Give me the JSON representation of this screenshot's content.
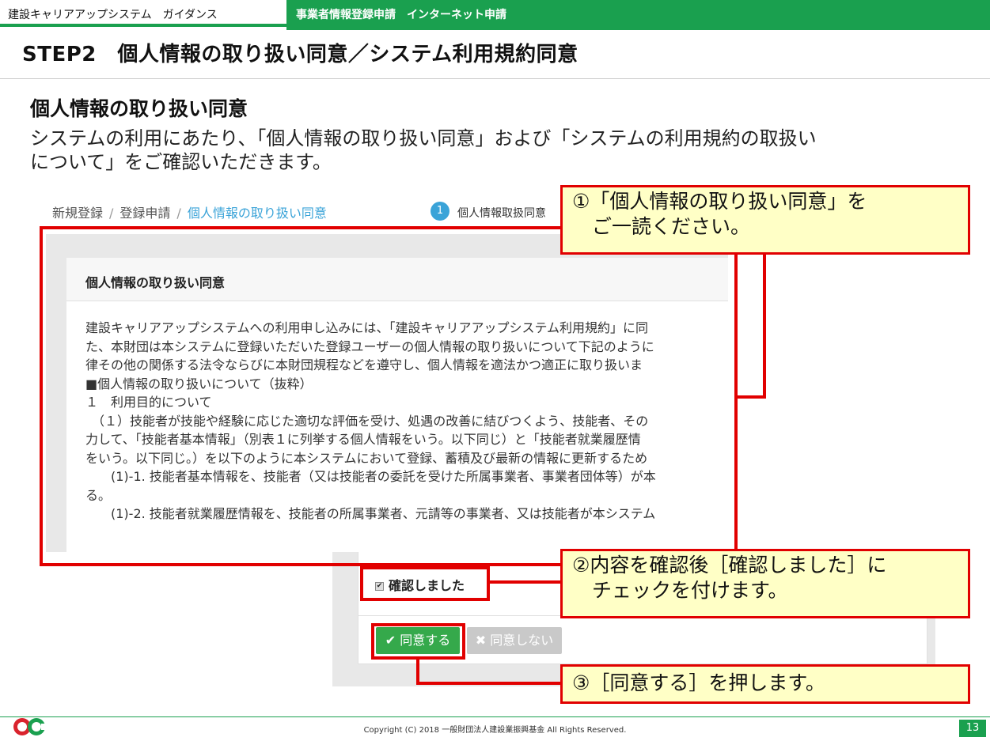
{
  "header": {
    "left_label": "建設キャリアアップシステム　ガイダンス",
    "right_label": "事業者情報登録申請　インターネット申請"
  },
  "step_title": "STEP2　個人情報の取り扱い同意／システム利用規約同意",
  "section": {
    "heading": "個人情報の取り扱い同意",
    "intro_line1": "システムの利用にあたり、「個人情報の取り扱い同意」および「システムの利用規約の取扱い",
    "intro_line2": "について」をご確認いただきます。"
  },
  "breadcrumb": {
    "items": [
      "新規登録",
      "登録申請",
      "個人情報の取り扱い同意"
    ],
    "separator": "/"
  },
  "step_indicator": {
    "number": "1",
    "label": "個人情報取扱同意"
  },
  "panel": {
    "title": "個人情報の取り扱い同意",
    "lines": [
      "建設キャリアアップシステムへの利用申し込みには、「建設キャリアアップシステム利用規約」に同",
      "た、本財団は本システムに登録いただいた登録ユーザーの個人情報の取り扱いについて下記のように",
      "律その他の関係する法令ならびに本財団規程などを遵守し、個人情報を適法かつ適正に取り扱いま",
      "■個人情報の取り扱いについて（抜粋）",
      "１　利用目的について",
      "　（１）技能者が技能や経験に応じた適切な評価を受け、処遇の改善に結びつくよう、技能者、その",
      "力して、「技能者基本情報」（別表１に列挙する個人情報をいう。以下同じ）と「技能者就業履歴情",
      "をいう。以下同じ。）を以下のように本システムにおいて登録、蓄積及び最新の情報に更新するため",
      "　　(1)-1. 技能者基本情報を、技能者（又は技能者の委託を受けた所属事業者、事業者団体等）が本",
      "る。",
      "　　(1)-2. 技能者就業履歴情報を、技能者の所属事業者、元請等の事業者、又は技能者が本システム"
    ]
  },
  "confirm": {
    "checkbox_label": "確認しました",
    "checked": true
  },
  "buttons": {
    "agree": "✔ 同意する",
    "disagree": "✖ 同意しない"
  },
  "callouts": {
    "c1_line1": "①「個人情報の取り扱い同意」を",
    "c1_line2": "　ご一読ください。",
    "c2_line1": "②内容を確認後［確認しました］に",
    "c2_line2": "　チェックを付けます。",
    "c3": "③［同意する］を押します。"
  },
  "footer": {
    "copyright": "Copyright (C) 2018 一般財団法人建設業振興基金 All Rights Reserved.",
    "page_number": "13"
  },
  "colors": {
    "brand_green": "#1aa04f",
    "highlight_red": "#e10000",
    "callout_yellow": "#ffffc6",
    "link_blue": "#3aa3d8",
    "agree_green": "#35a94b"
  }
}
